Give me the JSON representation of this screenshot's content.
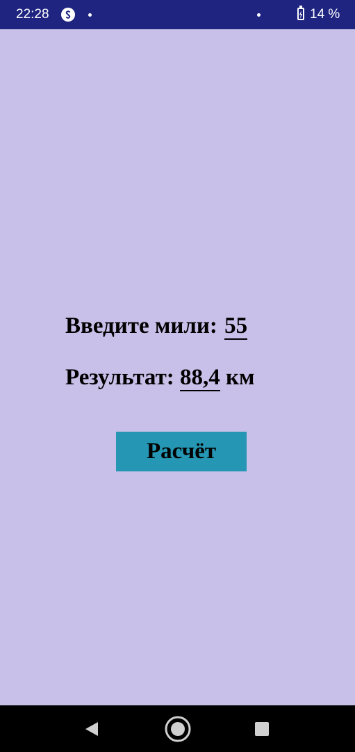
{
  "status_bar": {
    "time": "22:28",
    "battery": "14 %",
    "app_icon": "shazam-icon"
  },
  "main": {
    "input_label": "Введите мили:",
    "input_value": "55",
    "result_label": "Результат:",
    "result_value": "88,4",
    "result_unit": "км",
    "calc_button": "Расчёт"
  },
  "nav_bar": {
    "back_icon": "back-triangle-icon",
    "home_icon": "home-circle-icon",
    "recent_icon": "recents-square-icon"
  },
  "colors": {
    "background": "#c8c0e8",
    "status_bar": "#1e2480",
    "button": "#2596b3",
    "nav_bar": "#000000"
  }
}
